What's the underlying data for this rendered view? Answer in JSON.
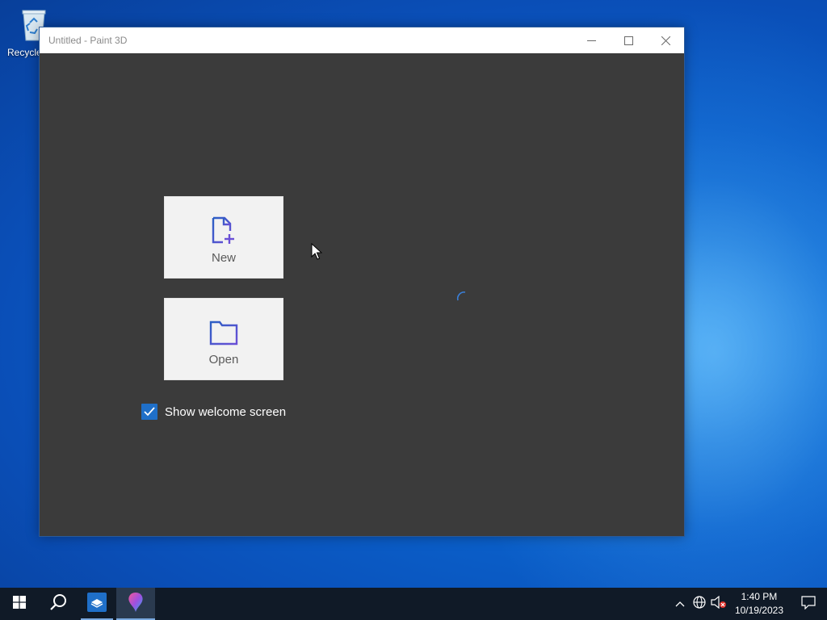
{
  "desktop": {
    "icons": [
      {
        "label": "Recycle Bin",
        "icon": "recycle-bin-icon"
      }
    ]
  },
  "window": {
    "title": "Untitled - Paint 3D",
    "controls": {
      "minimize": "minimize-icon",
      "maximize": "maximize-icon",
      "close": "close-icon"
    }
  },
  "welcome": {
    "new_label": "New",
    "open_label": "Open",
    "show_welcome_label": "Show welcome screen",
    "show_welcome_checked": true
  },
  "taskbar": {
    "items": [
      "start-icon",
      "search-icon",
      "task-view-app-icon",
      "paint-3d-icon"
    ],
    "clock_time": "1:40 PM",
    "clock_date": "10/19/2023"
  },
  "colors": {
    "accent": "#1f6fc8",
    "window_bg": "#3b3b3b",
    "icon_blue": "#2b5fc4",
    "icon_purple": "#6a4fd6"
  }
}
